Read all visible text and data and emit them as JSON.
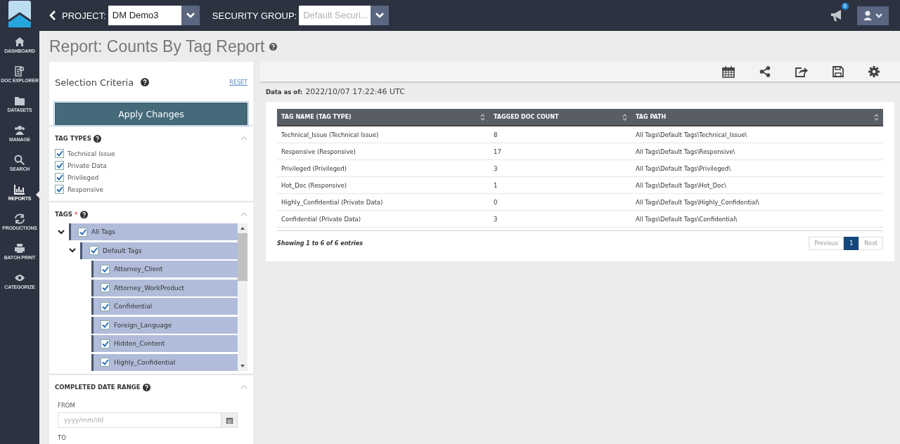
{
  "topbar": {
    "project_label": "PROJECT:",
    "project_value": "DM Demo3",
    "security_label": "SECURITY GROUP:",
    "security_placeholder": "Default Securi...",
    "notification_count": "0"
  },
  "nav": [
    {
      "label": "DASHBOARD",
      "kind": "home",
      "selected": false
    },
    {
      "label": "DOC EXPLORER",
      "kind": "doc",
      "selected": false
    },
    {
      "label": "DATASETS",
      "kind": "folder",
      "selected": false
    },
    {
      "label": "MANAGE",
      "kind": "users",
      "selected": false
    },
    {
      "label": "SEARCH",
      "kind": "search",
      "selected": false
    },
    {
      "label": "REPORTS",
      "kind": "chart",
      "selected": true
    },
    {
      "label": "PRODUCTIONS",
      "kind": "sync",
      "selected": false
    },
    {
      "label": "BATCH PRINT",
      "kind": "print",
      "selected": false
    },
    {
      "label": "CATEGORIZE",
      "kind": "eye",
      "selected": false
    }
  ],
  "title": "Report: Counts By Tag Report",
  "criteria": {
    "heading": "Selection Criteria",
    "reset": "RESET",
    "apply": "Apply Changes"
  },
  "tag_types": {
    "heading": "TAG TYPES",
    "items": [
      {
        "label": "Technical Issue",
        "checked": true
      },
      {
        "label": "Private Data",
        "checked": true
      },
      {
        "label": "Privileged",
        "checked": true
      },
      {
        "label": "Responsive",
        "checked": true
      }
    ]
  },
  "tags": {
    "heading": "TAGS",
    "required": "*",
    "tree": [
      {
        "label": "All Tags",
        "checked": true,
        "expanded": true,
        "children": [
          {
            "label": "Default Tags",
            "checked": true,
            "expanded": true,
            "children": [
              {
                "label": "Attorney_Client",
                "checked": true
              },
              {
                "label": "Attorney_WorkProduct",
                "checked": true
              },
              {
                "label": "Confidential",
                "checked": true
              },
              {
                "label": "Foreign_Language",
                "checked": true
              },
              {
                "label": "Hidden_Content",
                "checked": true
              },
              {
                "label": "Highly_Confidential",
                "checked": true
              }
            ]
          }
        ]
      }
    ]
  },
  "date_range": {
    "heading": "COMPLETED DATE RANGE",
    "from_label": "FROM",
    "from_placeholder": "yyyy/mm/dd",
    "to_label": "TO"
  },
  "report": {
    "data_as_of_label": "Data as of:",
    "data_as_of_value": "2022/10/07 17:22:46 UTC",
    "columns": [
      "TAG NAME (TAG TYPE)",
      "TAGGED DOC COUNT",
      "TAG PATH"
    ],
    "rows": [
      [
        "Technical_Issue (Technical Issue)",
        "8",
        "All Tags\\Default Tags\\Technical_Issue\\"
      ],
      [
        "Responsive (Responsive)",
        "17",
        "All Tags\\Default Tags\\Responsive\\"
      ],
      [
        "Privileged (Privileged)",
        "3",
        "All Tags\\Default Tags\\Privileged\\"
      ],
      [
        "Hot_Doc (Responsive)",
        "1",
        "All Tags\\Default Tags\\Hot_Doc\\"
      ],
      [
        "Highly_Confidential (Private Data)",
        "0",
        "All Tags\\Default Tags\\Highly_Confidential\\"
      ],
      [
        "Confidential (Private Data)",
        "3",
        "All Tags\\Default Tags\\Confidential\\"
      ]
    ],
    "info": "Showing 1 to 6 of 6 entries",
    "pagination": {
      "previous": "Previous",
      "pages": [
        {
          "label": "1",
          "selected": true
        }
      ],
      "next": "Next"
    }
  }
}
